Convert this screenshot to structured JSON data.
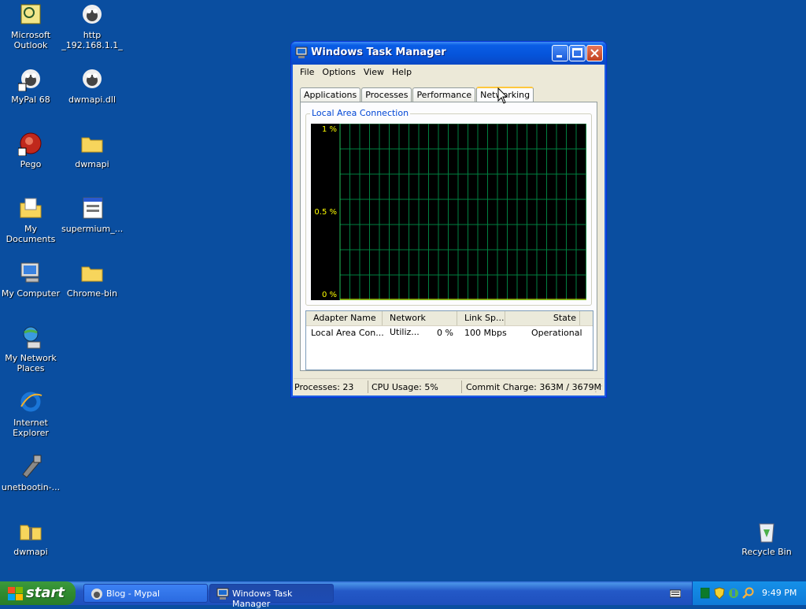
{
  "desktop": {
    "icons": [
      {
        "label": "Microsoft Outlook",
        "name": "outlook"
      },
      {
        "label": "http _192.168.1.1_",
        "name": "http-shortcut"
      },
      {
        "label": "MyPal 68",
        "name": "mypal"
      },
      {
        "label": "dwmapi.dll",
        "name": "dwmapi-dll"
      },
      {
        "label": "Pego",
        "name": "pego"
      },
      {
        "label": "dwmapi",
        "name": "dwmapi-folder"
      },
      {
        "label": "My Documents",
        "name": "my-documents"
      },
      {
        "label": "supermium_...",
        "name": "supermium"
      },
      {
        "label": "My Computer",
        "name": "my-computer"
      },
      {
        "label": "Chrome-bin",
        "name": "chrome-bin"
      },
      {
        "label": "My Network Places",
        "name": "network-places"
      },
      {
        "label": "Internet Explorer",
        "name": "internet-explorer"
      },
      {
        "label": "unetbootin-...",
        "name": "unetbootin"
      },
      {
        "label": "dwmapi",
        "name": "dwmapi-zip"
      },
      {
        "label": "Recycle Bin",
        "name": "recycle-bin"
      }
    ]
  },
  "window": {
    "title": "Windows Task Manager",
    "menu": [
      "File",
      "Options",
      "View",
      "Help"
    ],
    "tabs": [
      "Applications",
      "Processes",
      "Performance",
      "Networking"
    ],
    "active_tab": "Networking",
    "group_title": "Local Area Connection",
    "graph_labels": [
      "1 %",
      "0.5 %",
      "0 %"
    ],
    "list": {
      "headers": [
        "Adapter Name",
        "Network Utiliz...",
        "Link Sp...",
        "State"
      ],
      "rows": [
        [
          "Local Area Con...",
          "0 %",
          "100 Mbps",
          "Operational"
        ]
      ]
    },
    "status": {
      "processes": "Processes: 23",
      "cpu": "CPU Usage: 5%",
      "commit": "Commit Charge: 363M / 3679M"
    }
  },
  "chart_data": {
    "type": "line",
    "title": "Local Area Connection",
    "yticks": [
      "1 %",
      "0.5 %",
      "0 %"
    ],
    "ylim": [
      0,
      1
    ],
    "grid": true,
    "series": [
      {
        "values": [
          0,
          0,
          0,
          0,
          0,
          0,
          0,
          0,
          0,
          0,
          0,
          0,
          0,
          0,
          0,
          0,
          0,
          0,
          0,
          0,
          0,
          0,
          0,
          0,
          0,
          0,
          0,
          0,
          0,
          0,
          0,
          0,
          0,
          0,
          0,
          0,
          0,
          0,
          0,
          0,
          0,
          0,
          0,
          0,
          0,
          0,
          0,
          0,
          0,
          0,
          0,
          0,
          0
        ]
      }
    ]
  },
  "taskbar": {
    "start": "start",
    "buttons": [
      "Blog - Mypal",
      "Windows Task Manager"
    ],
    "time": "9:49 PM"
  },
  "colors": {
    "desktop": "#0a4ea0",
    "graph_grid": "#008040",
    "graph_label": "#ffff00"
  }
}
